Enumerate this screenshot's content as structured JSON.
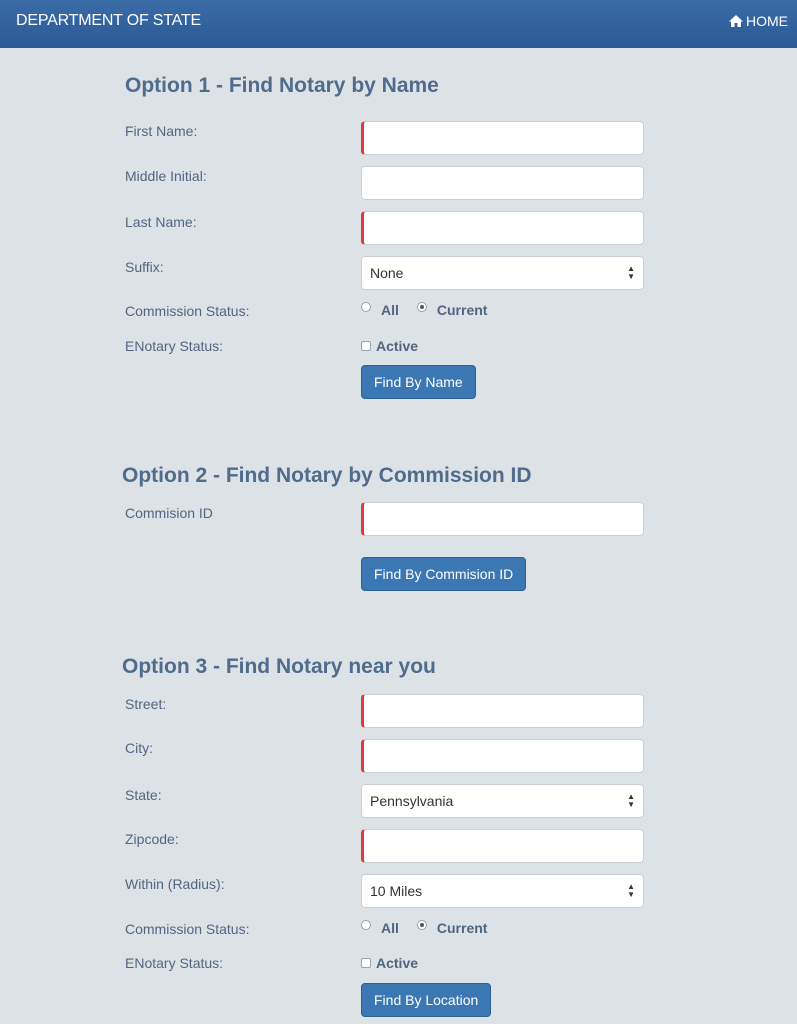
{
  "header": {
    "brand": "DEPARTMENT OF STATE",
    "home_label": "HOME"
  },
  "option1": {
    "title": "Option 1 - Find Notary by Name",
    "first_name_label": "First Name:",
    "middle_initial_label": "Middle Initial:",
    "last_name_label": "Last Name:",
    "suffix_label": "Suffix:",
    "suffix_value": "None",
    "commission_status_label": "Commission Status:",
    "radio_all": "All",
    "radio_current": "Current",
    "enotary_label": "ENotary Status:",
    "active_label": "Active",
    "button": "Find By Name"
  },
  "option2": {
    "title": "Option 2 - Find Notary by Commission ID",
    "commission_id_label": "Commision ID",
    "button": "Find By Commision ID"
  },
  "option3": {
    "title": "Option 3 - Find Notary near you",
    "street_label": "Street:",
    "city_label": "City:",
    "state_label": "State:",
    "state_value": "Pennsylvania",
    "zipcode_label": "Zipcode:",
    "radius_label": "Within (Radius):",
    "radius_value": "10 Miles",
    "commission_status_label": "Commission Status:",
    "radio_all": "All",
    "radio_current": "Current",
    "enotary_label": "ENotary Status:",
    "active_label": "Active",
    "button": "Find By Location"
  },
  "colors": {
    "header": "#2f5f9c",
    "required_marker": "#e03a3a",
    "button": "#3a77b3"
  }
}
